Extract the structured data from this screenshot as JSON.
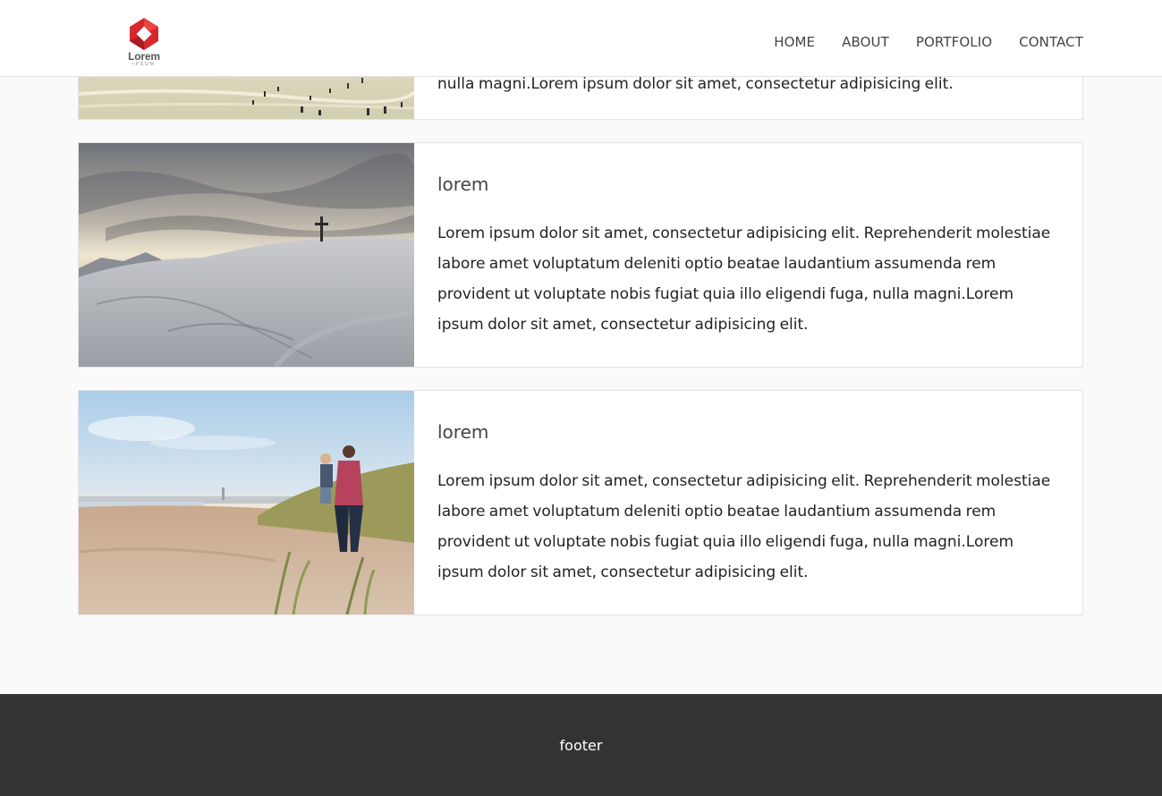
{
  "header": {
    "logo": {
      "word": "Lorem",
      "sub": "IPSUM"
    },
    "nav": [
      {
        "label": "HOME"
      },
      {
        "label": "ABOUT"
      },
      {
        "label": "PORTFOLIO"
      },
      {
        "label": "CONTACT"
      }
    ]
  },
  "posts": [
    {
      "image": "beach-crowd-photo",
      "text": "nulla magni.Lorem ipsum dolor sit amet, consectetur adipisicing elit."
    },
    {
      "image": "snowy-hill-cross-photo",
      "title": "lorem",
      "text": "Lorem ipsum dolor sit amet, consectetur adipisicing elit. Reprehenderit molestiae labore amet voluptatum deleniti optio beatae laudantium assumenda rem provident ut voluptate nobis fugiat quia illo eligendi fuga, nulla magni.Lorem ipsum dolor sit amet, consectetur adipisicing elit."
    },
    {
      "image": "father-child-beach-photo",
      "title": "lorem",
      "text": "Lorem ipsum dolor sit amet, consectetur adipisicing elit. Reprehenderit molestiae labore amet voluptatum deleniti optio beatae laudantium assumenda rem provident ut voluptate nobis fugiat quia illo eligendi fuga, nulla magni.Lorem ipsum dolor sit amet, consectetur adipisicing elit."
    }
  ],
  "footer": {
    "text": "footer"
  },
  "colors": {
    "logo_red": "#d6282c",
    "footer_bg": "#333333",
    "page_bg": "#fafafa"
  }
}
